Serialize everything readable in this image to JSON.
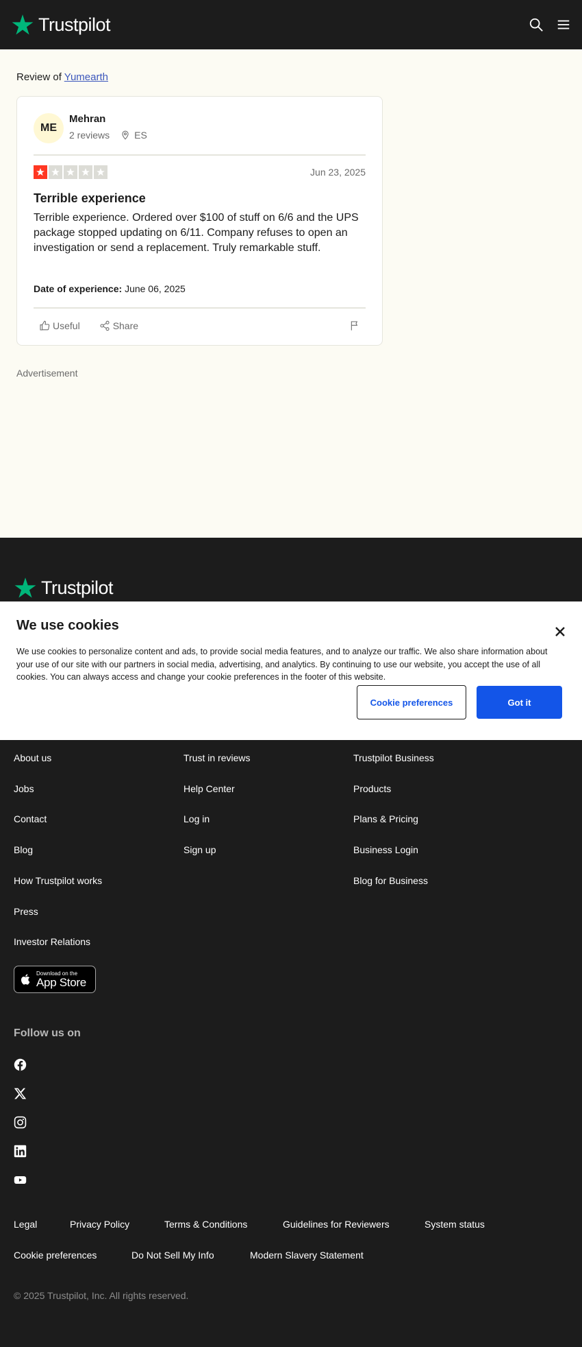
{
  "header": {
    "brand": "Trustpilot",
    "brand_color": "#00b67a",
    "icons": [
      "search-icon",
      "menu-icon"
    ]
  },
  "review_page": {
    "review_of_prefix": "Review of",
    "company": "Yumearth",
    "reviewer": {
      "initials": "ME",
      "name": "Mehran",
      "review_count": "2 reviews",
      "country": "ES"
    },
    "rating": 1,
    "rating_max": 5,
    "date": "Jun 23, 2025",
    "title": "Terrible experience",
    "body": "Terrible experience. Ordered over $100 of stuff on 6/6 and the UPS package stopped updating on 6/11. Company refuses to open an investigation or send a replacement. Truly remarkable stuff.",
    "experience_label": "Date of experience:",
    "experience_date": "June 06, 2025",
    "actions": {
      "useful": "Useful",
      "share": "Share"
    }
  },
  "advertisement_label": "Advertisement",
  "cookie_banner": {
    "title": "We use cookies",
    "text": "We use cookies to personalize content and ads, to provide social media features, and to analyze our traffic. We also share information about your use of our site with our partners in social media, advertising, and analytics. By continuing to use our website, you accept the use of all cookies. You can always access and change your cookie preferences in the footer of this website.",
    "preferences_button": "Cookie preferences",
    "accept_button": "Got it",
    "accent_color": "#1355e8"
  },
  "footer": {
    "brand": "Trustpilot",
    "col1": [
      "About us",
      "Jobs",
      "Contact",
      "Blog",
      "How Trustpilot works",
      "Press",
      "Investor Relations"
    ],
    "col2": [
      "Trust in reviews",
      "Help Center",
      "Log in",
      "Sign up"
    ],
    "col3": [
      "Trustpilot Business",
      "Products",
      "Plans & Pricing",
      "Business Login",
      "Blog for Business"
    ],
    "app_store_small": "Download on the",
    "app_store_big": "App Store",
    "follow_label": "Follow us on",
    "social": [
      "facebook-icon",
      "x-icon",
      "instagram-icon",
      "linkedin-icon",
      "youtube-icon"
    ],
    "legal_row1": [
      "Legal",
      "Privacy Policy",
      "Terms & Conditions",
      "Guidelines for Reviewers",
      "System status"
    ],
    "legal_row2": [
      "Cookie preferences",
      "Do Not Sell My Info",
      "Modern Slavery Statement"
    ],
    "copyright": "© 2025 Trustpilot, Inc. All rights reserved."
  }
}
